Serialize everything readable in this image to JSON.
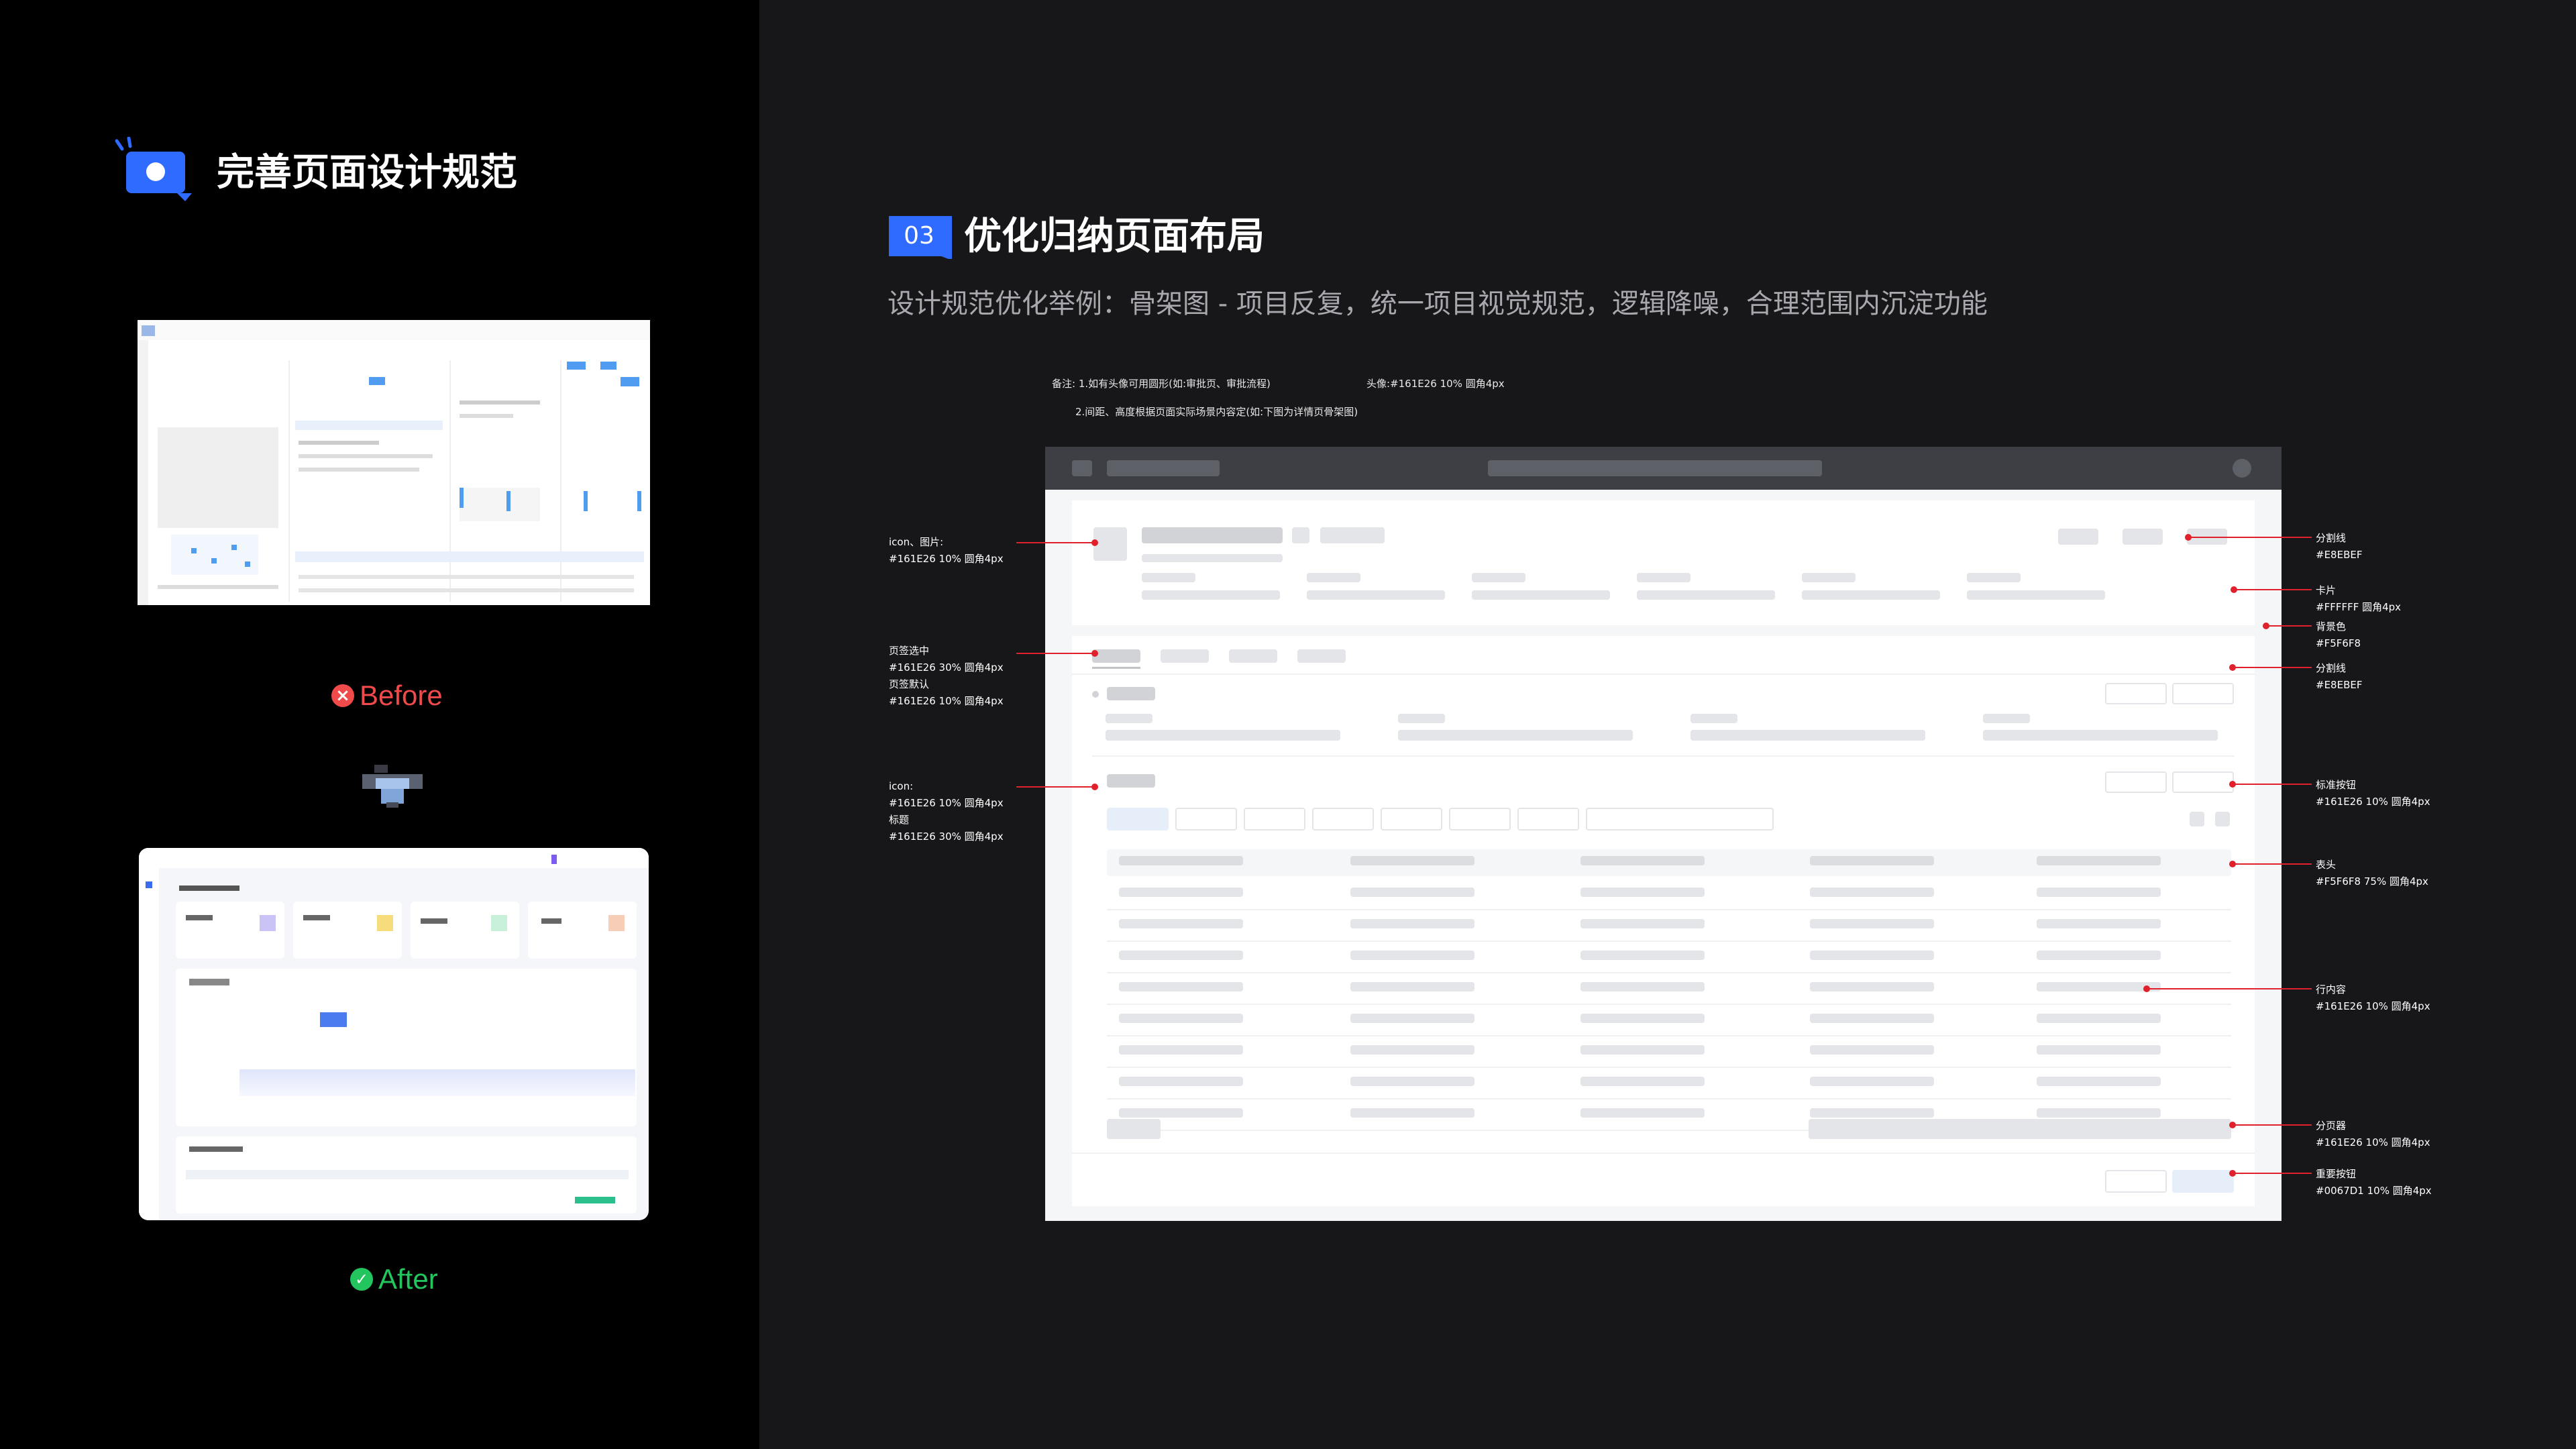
{
  "header": {
    "title": "完善页面设计规范",
    "icon": "chat-bubble-icon",
    "accent": "#2f6bff"
  },
  "compare": {
    "before_label": "Before",
    "after_label": "After",
    "before_color": "#f04a4a",
    "after_color": "#22c55e"
  },
  "section": {
    "number": "03",
    "title": "优化归纳页面布局",
    "subtitle": "设计规范优化举例：骨架图 - 项目反复，统一项目视觉规范，逻辑降噪，合理范围内沉淀功能",
    "badge_color": "#2f6bff"
  },
  "notes": {
    "line1": "备注: 1.如有头像可用圆形(如:审批页、审批流程)",
    "avatar": "头像:#161E26 10% 圆角4px",
    "line2": "2.间距、高度根据页面实际场景内容定(如:下图为详情页骨架图)"
  },
  "left_annotations": [
    {
      "lines": [
        "icon、图片:",
        "#161E26 10% 圆角4px"
      ]
    },
    {
      "lines": [
        "页签选中",
        "#161E26 30% 圆角4px",
        "页签默认",
        "#161E26 10% 圆角4px"
      ]
    },
    {
      "lines": [
        "icon:",
        "#161E26 10% 圆角4px",
        "标题",
        "#161E26 30% 圆角4px"
      ]
    }
  ],
  "right_annotations": [
    {
      "lines": [
        "分割线",
        "#E8EBEF"
      ]
    },
    {
      "lines": [
        "卡片",
        "#FFFFFF 圆角4px"
      ]
    },
    {
      "lines": [
        "背景色",
        "#F5F6F8"
      ]
    },
    {
      "lines": [
        "分割线",
        "#E8EBEF"
      ]
    },
    {
      "lines": [
        "标准按钮",
        "#161E26 10% 圆角4px"
      ]
    },
    {
      "lines": [
        "表头",
        "#F5F6F8 75% 圆角4px"
      ]
    },
    {
      "lines": [
        "行内容",
        "#161E26 10% 圆角4px"
      ]
    },
    {
      "lines": [
        "分页器",
        "#161E26 10% 圆角4px"
      ]
    },
    {
      "lines": [
        "重要按钮",
        "#0067D1 10% 圆角4px"
      ]
    }
  ]
}
